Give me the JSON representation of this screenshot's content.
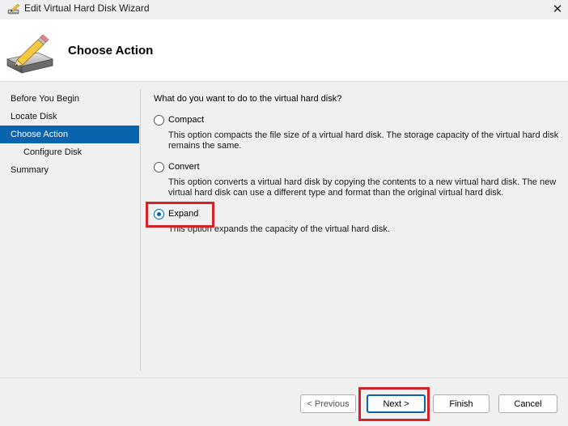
{
  "window": {
    "title": "Edit Virtual Hard Disk Wizard",
    "close_glyph": "✕"
  },
  "header": {
    "title": "Choose Action",
    "icon": "hard-disk-pencil-icon"
  },
  "nav": {
    "items": [
      {
        "label": "Before You Begin",
        "active": false
      },
      {
        "label": "Locate Disk",
        "active": false
      },
      {
        "label": "Choose Action",
        "active": true
      },
      {
        "label": "Configure Disk",
        "active": false,
        "sub": true
      },
      {
        "label": "Summary",
        "active": false
      }
    ]
  },
  "content": {
    "question": "What do you want to do to the virtual hard disk?",
    "options": [
      {
        "label": "Compact",
        "selected": false,
        "description": "This option compacts the file size of a virtual hard disk. The storage capacity of the virtual hard disk remains the same."
      },
      {
        "label": "Convert",
        "selected": false,
        "description": "This option converts a virtual hard disk by copying the contents to a new virtual hard disk. The new virtual hard disk can use a different type and format than the original virtual hard disk."
      },
      {
        "label": "Expand",
        "selected": true,
        "description": "This option expands the capacity of the virtual hard disk."
      }
    ]
  },
  "buttons": {
    "previous": "< Previous",
    "next": "Next >",
    "finish": "Finish",
    "cancel": "Cancel"
  },
  "colors": {
    "accent": "#0a64ad",
    "highlight": "#d2232a"
  }
}
